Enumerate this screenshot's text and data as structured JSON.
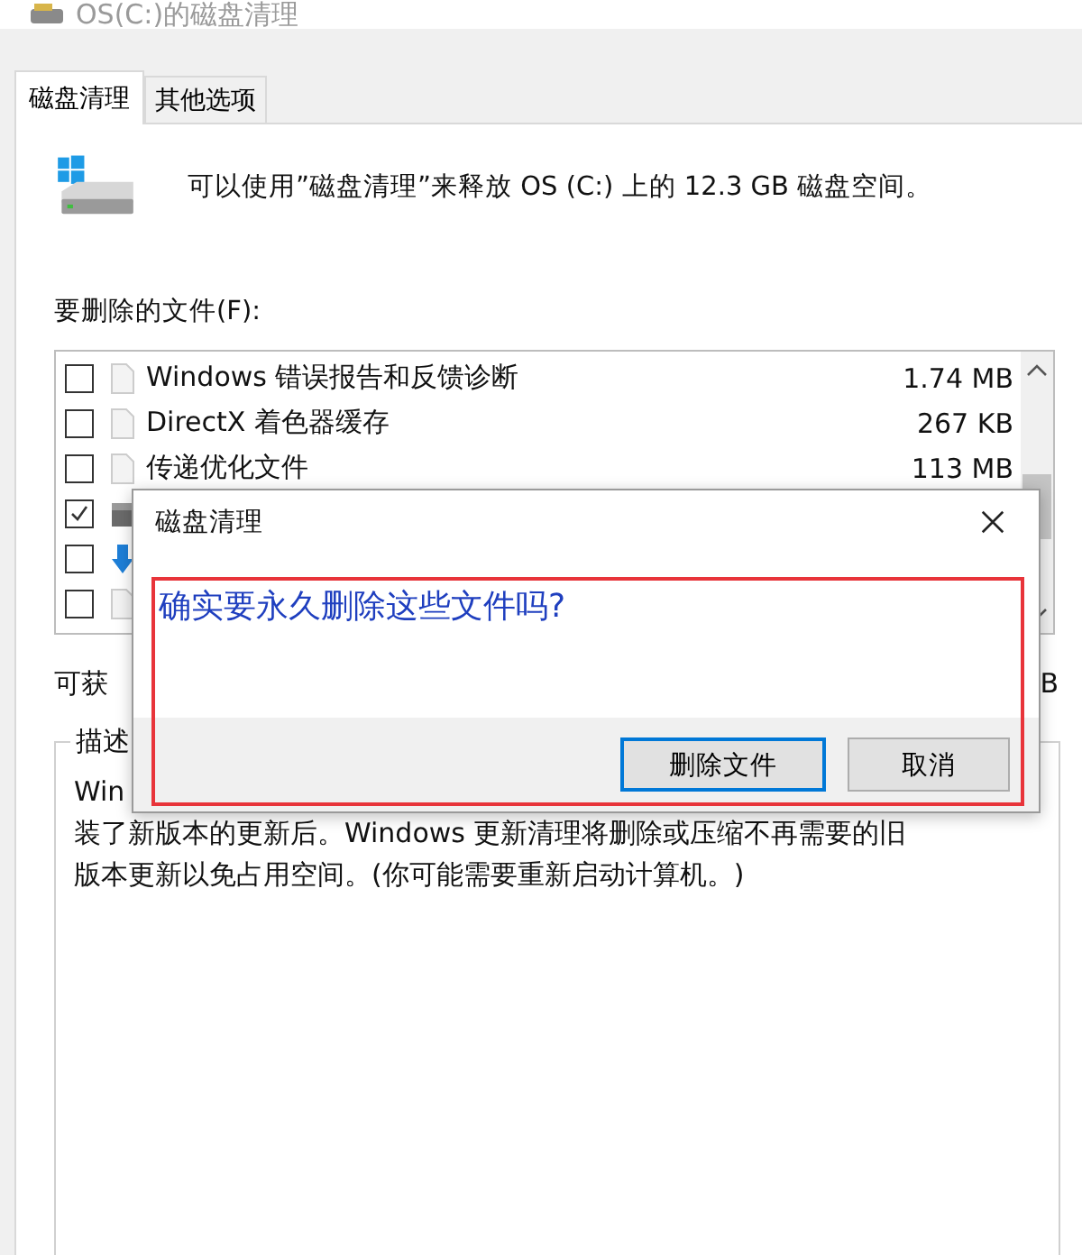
{
  "window": {
    "title": "OS(C:)的磁盘清理"
  },
  "tabs": [
    {
      "label": "磁盘清理",
      "selected": true
    },
    {
      "label": "其他选项",
      "selected": false
    }
  ],
  "summary": "可以使用”磁盘清理”来释放 OS (C:) 上的 12.3 GB 磁盘空间。",
  "files_label": "要删除的文件(F):",
  "files": [
    {
      "kind": "doc",
      "name": "Windows 错误报告和反馈诊断",
      "size": "1.74 MB",
      "checked": false
    },
    {
      "kind": "doc",
      "name": "DirectX 着色器缓存",
      "size": "267 KB",
      "checked": false
    },
    {
      "kind": "doc",
      "name": "传递优化文件",
      "size": "113 MB",
      "checked": false
    },
    {
      "kind": "drive",
      "checked": true
    },
    {
      "kind": "arrow",
      "checked": false
    },
    {
      "kind": "doc",
      "checked": false
    }
  ],
  "gain": {
    "label": "可获",
    "value": "B"
  },
  "description": {
    "title": "描述",
    "lines": [
      "Win",
      "装了新版本的更新后。Windows 更新清理将删除或压缩不再需要的旧",
      "版本更新以免占用空间。(你可能需要重新启动计算机。)"
    ]
  },
  "dialog": {
    "title": "磁盘清理",
    "message": "确实要永久删除这些文件吗?",
    "buttons": [
      {
        "label": "删除文件",
        "default": true
      },
      {
        "label": "取消",
        "default": false
      }
    ]
  }
}
